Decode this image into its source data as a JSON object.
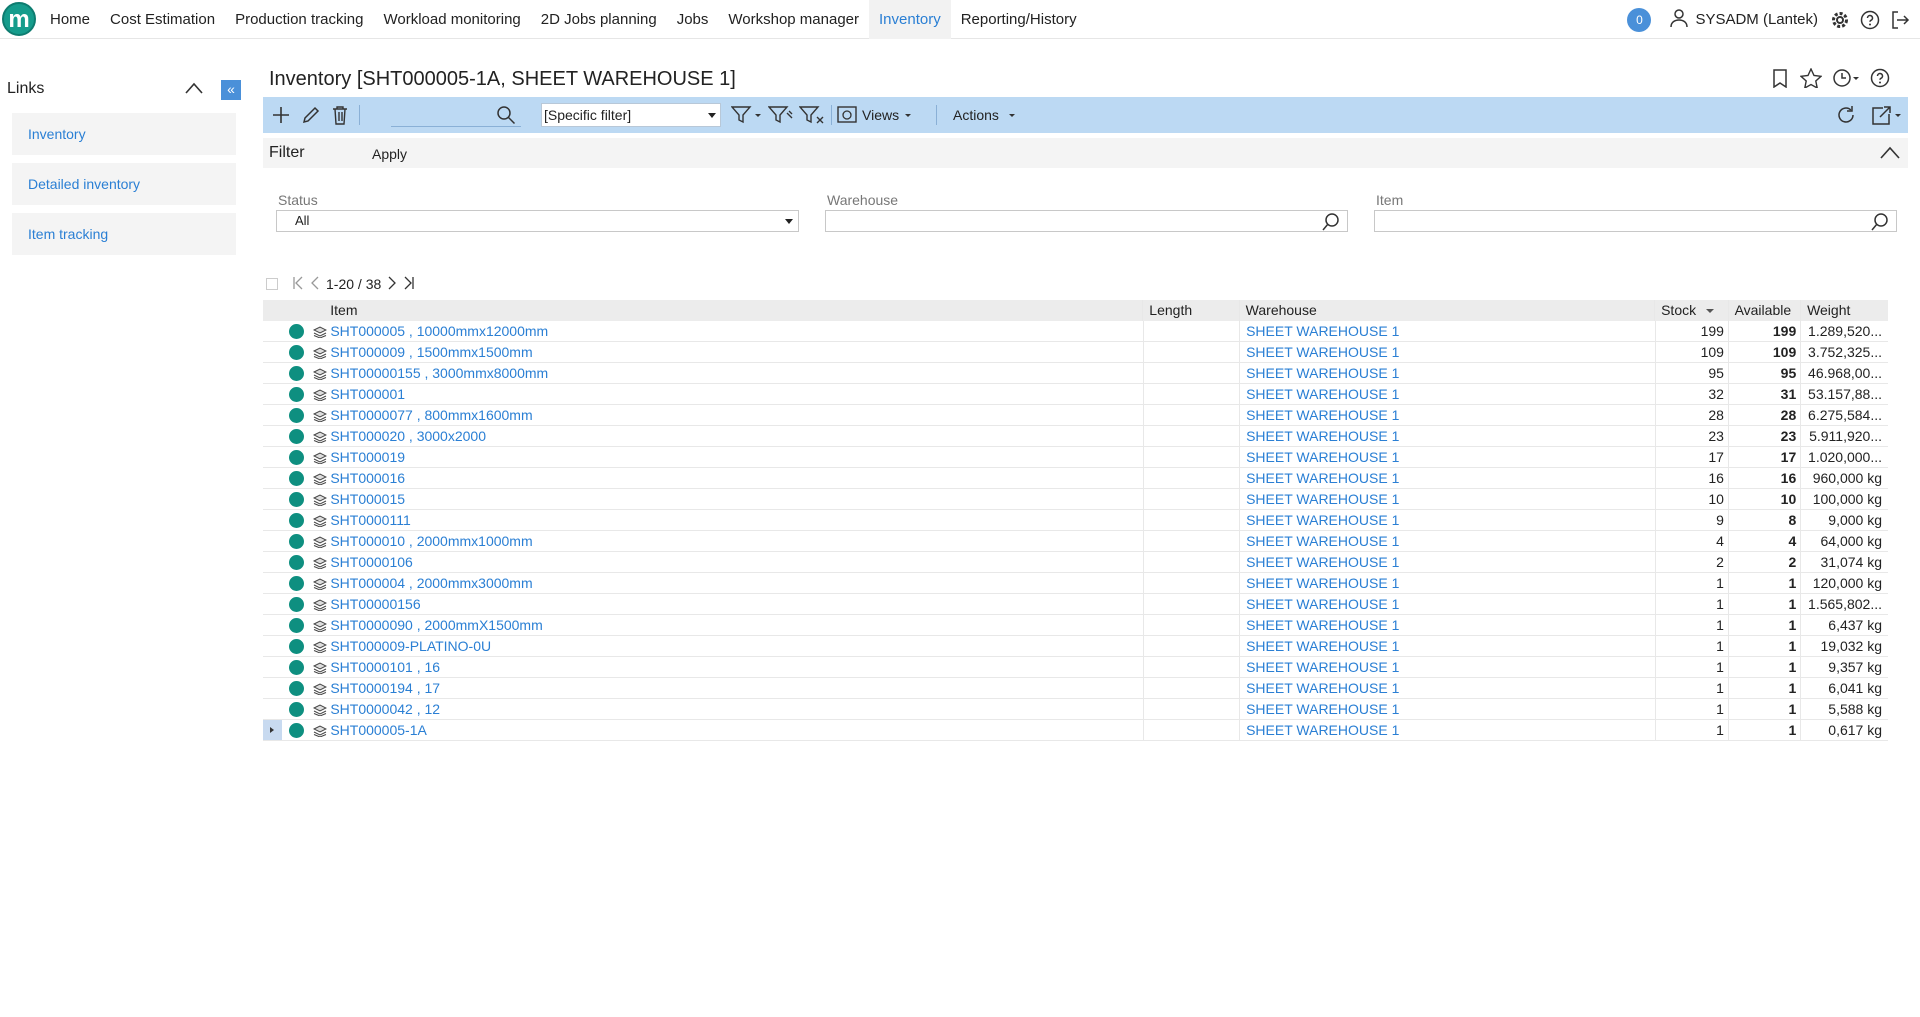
{
  "nav": {
    "items": [
      "Home",
      "Cost Estimation",
      "Production tracking",
      "Workload monitoring",
      "2D Jobs planning",
      "Jobs",
      "Workshop manager",
      "Inventory",
      "Reporting/History"
    ],
    "active": "Inventory",
    "notifications": "0",
    "user": "SYSADM (Lantek)"
  },
  "logo_letter": "m",
  "links": {
    "title": "Links",
    "items": [
      "Inventory",
      "Detailed inventory",
      "Item tracking"
    ]
  },
  "page_title": "Inventory [SHT000005-1A, SHEET WAREHOUSE 1]",
  "toolbar": {
    "filter_select": "[Specific filter]",
    "views_label": "Views",
    "actions_label": "Actions"
  },
  "filter": {
    "label": "Filter",
    "apply": "Apply",
    "fields": {
      "status_label": "Status",
      "status_value": "All",
      "warehouse_label": "Warehouse",
      "warehouse_value": "",
      "item_label": "Item",
      "item_value": ""
    }
  },
  "pager": {
    "range": "1-20 / 38"
  },
  "grid": {
    "headers": {
      "item": "Item",
      "length": "Length",
      "warehouse": "Warehouse",
      "stock": "Stock",
      "available": "Available",
      "weight": "Weight"
    },
    "rows": [
      {
        "item": "SHT000005 , 10000mmx12000mm",
        "length": "",
        "warehouse": "SHEET WAREHOUSE 1",
        "stock": "199",
        "available": "199",
        "weight": "1.289,520..."
      },
      {
        "item": "SHT000009 , 1500mmx1500mm",
        "length": "",
        "warehouse": "SHEET WAREHOUSE 1",
        "stock": "109",
        "available": "109",
        "weight": "3.752,325..."
      },
      {
        "item": "SHT00000155 , 3000mmx8000mm",
        "length": "",
        "warehouse": "SHEET WAREHOUSE 1",
        "stock": "95",
        "available": "95",
        "weight": "46.968,00..."
      },
      {
        "item": "SHT000001",
        "length": "",
        "warehouse": "SHEET WAREHOUSE 1",
        "stock": "32",
        "available": "31",
        "weight": "53.157,88..."
      },
      {
        "item": "SHT0000077 , 800mmx1600mm",
        "length": "",
        "warehouse": "SHEET WAREHOUSE 1",
        "stock": "28",
        "available": "28",
        "weight": "6.275,584..."
      },
      {
        "item": "SHT000020 , 3000x2000",
        "length": "",
        "warehouse": "SHEET WAREHOUSE 1",
        "stock": "23",
        "available": "23",
        "weight": "5.911,920..."
      },
      {
        "item": "SHT000019",
        "length": "",
        "warehouse": "SHEET WAREHOUSE 1",
        "stock": "17",
        "available": "17",
        "weight": "1.020,000..."
      },
      {
        "item": "SHT000016",
        "length": "",
        "warehouse": "SHEET WAREHOUSE 1",
        "stock": "16",
        "available": "16",
        "weight": "960,000 kg"
      },
      {
        "item": "SHT000015",
        "length": "",
        "warehouse": "SHEET WAREHOUSE 1",
        "stock": "10",
        "available": "10",
        "weight": "100,000 kg"
      },
      {
        "item": "SHT0000111",
        "length": "",
        "warehouse": "SHEET WAREHOUSE 1",
        "stock": "9",
        "available": "8",
        "weight": "9,000 kg"
      },
      {
        "item": "SHT000010 , 2000mmx1000mm",
        "length": "",
        "warehouse": "SHEET WAREHOUSE 1",
        "stock": "4",
        "available": "4",
        "weight": "64,000 kg"
      },
      {
        "item": "SHT0000106",
        "length": "",
        "warehouse": "SHEET WAREHOUSE 1",
        "stock": "2",
        "available": "2",
        "weight": "31,074 kg"
      },
      {
        "item": "SHT000004 , 2000mmx3000mm",
        "length": "",
        "warehouse": "SHEET WAREHOUSE 1",
        "stock": "1",
        "available": "1",
        "weight": "120,000 kg"
      },
      {
        "item": "SHT00000156",
        "length": "",
        "warehouse": "SHEET WAREHOUSE 1",
        "stock": "1",
        "available": "1",
        "weight": "1.565,802..."
      },
      {
        "item": "SHT0000090 , 2000mmX1500mm",
        "length": "",
        "warehouse": "SHEET WAREHOUSE 1",
        "stock": "1",
        "available": "1",
        "weight": "6,437 kg"
      },
      {
        "item": "SHT000009-PLATINO-0U",
        "length": "",
        "warehouse": "SHEET WAREHOUSE 1",
        "stock": "1",
        "available": "1",
        "weight": "19,032 kg"
      },
      {
        "item": "SHT0000101 , 16",
        "length": "",
        "warehouse": "SHEET WAREHOUSE 1",
        "stock": "1",
        "available": "1",
        "weight": "9,357 kg"
      },
      {
        "item": "SHT0000194 , 17",
        "length": "",
        "warehouse": "SHEET WAREHOUSE 1",
        "stock": "1",
        "available": "1",
        "weight": "6,041 kg"
      },
      {
        "item": "SHT0000042 , 12",
        "length": "",
        "warehouse": "SHEET WAREHOUSE 1",
        "stock": "1",
        "available": "1",
        "weight": "5,588 kg"
      },
      {
        "item": "SHT000005-1A",
        "length": "",
        "warehouse": "SHEET WAREHOUSE 1",
        "stock": "1",
        "available": "1",
        "weight": "0,617 kg"
      }
    ]
  },
  "colors": {
    "accent": "#2a7fd4",
    "toolbar_bg": "#bcd9f3",
    "status_ok": "#0e8f80"
  }
}
